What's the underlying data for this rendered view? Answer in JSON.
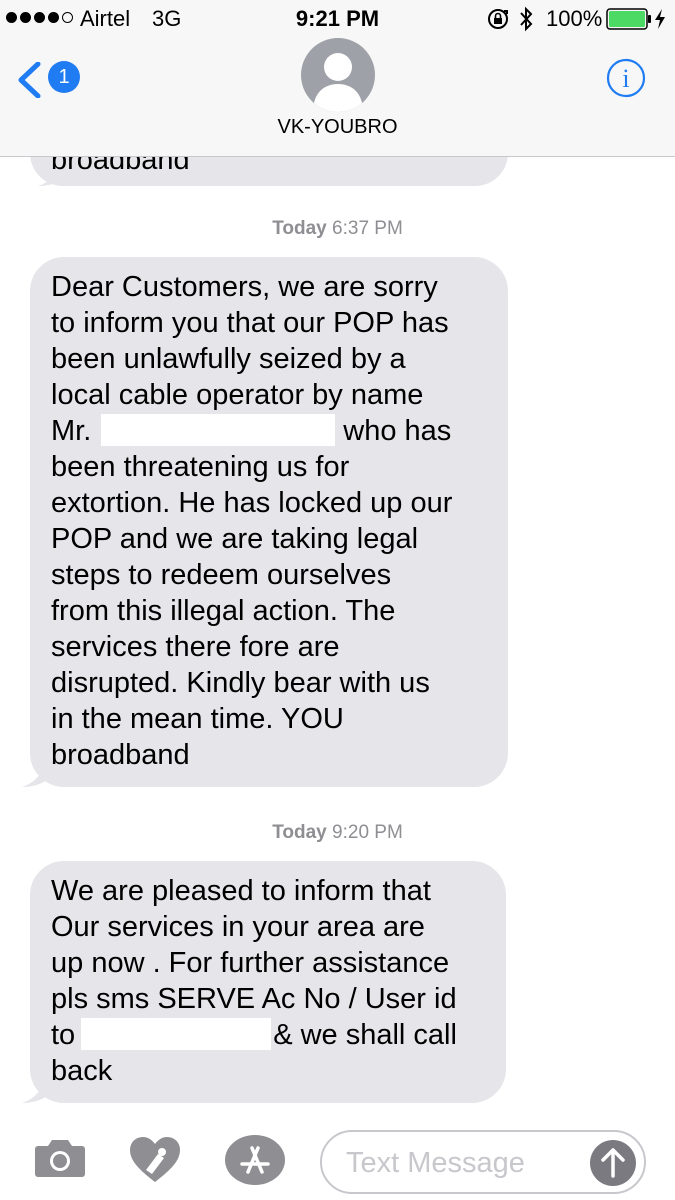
{
  "status_bar": {
    "carrier": "Airtel",
    "network": "3G",
    "time": "9:21 PM",
    "battery_percent": "100%",
    "battery_color": "#4cd964",
    "signal_icon": "signal-dots-icon",
    "signal_bars": 4,
    "signal_bars_total": 5,
    "icons": [
      "orientation-lock-icon",
      "bluetooth-icon",
      "battery-icon",
      "charging-bolt-icon"
    ]
  },
  "nav": {
    "back_badge": "1",
    "contact_name": "VK-YOUBRO",
    "accent_color": "#1f7cf2",
    "icons": [
      "back-chevron-icon",
      "contact-avatar-icon",
      "info-icon"
    ]
  },
  "conversation": {
    "previous_message_tail": "broadband",
    "messages": [
      {
        "timestamp_day": "Today",
        "timestamp_time": "6:37 PM",
        "text_before_redaction": "Dear Customers, we are sorry\nto inform you that our POP has\nbeen unlawfully seized by a\nlocal cable operator by name\nMr.",
        "text_after_redaction": "who has\nbeen threatening us for\nextortion. He has locked up our\nPOP and we are taking legal\nsteps to redeem ourselves\nfrom this illegal action. The\nservices there fore are\ndisrupted. Kindly bear with us\nin the mean time. YOU\nbroadband"
      },
      {
        "timestamp_day": "Today",
        "timestamp_time": "9:20 PM",
        "text_before_redaction": "We are pleased to inform that\nOur services in your area are\nup now . For further assistance\npls sms SERVE Ac No / User id\nto",
        "text_after_redaction": "& we shall call\nback"
      }
    ],
    "bubble_color": "#e5e5ea",
    "timestamp_color": "#8e8e93"
  },
  "input_bar": {
    "placeholder": "Text Message",
    "icons": [
      "camera-icon",
      "digital-touch-icon",
      "app-store-icon",
      "send-arrow-icon"
    ]
  }
}
